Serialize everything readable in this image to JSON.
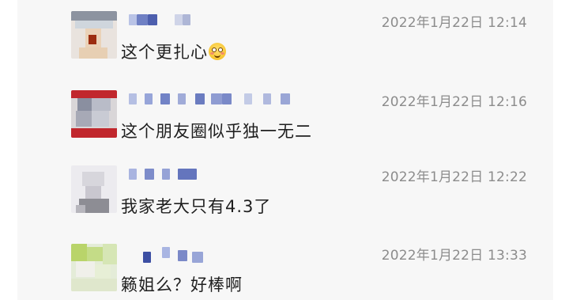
{
  "comments": [
    {
      "time": "2022年1月22日 12:14",
      "text": "这个更扎心",
      "emoji": "flushed-face-emoji"
    },
    {
      "time": "2022年1月22日 12:16",
      "text": "这个朋友圈似乎独一无二"
    },
    {
      "time": "2022年1月22日 12:22",
      "text": "我家老大只有4.3了"
    },
    {
      "time": "2022年1月22日 13:33",
      "text": "籁姐么？好棒啊"
    }
  ],
  "colors": {
    "background": "#f7f7f7",
    "time_text": "#8c8c8c",
    "body_text": "#1f1f1f"
  }
}
